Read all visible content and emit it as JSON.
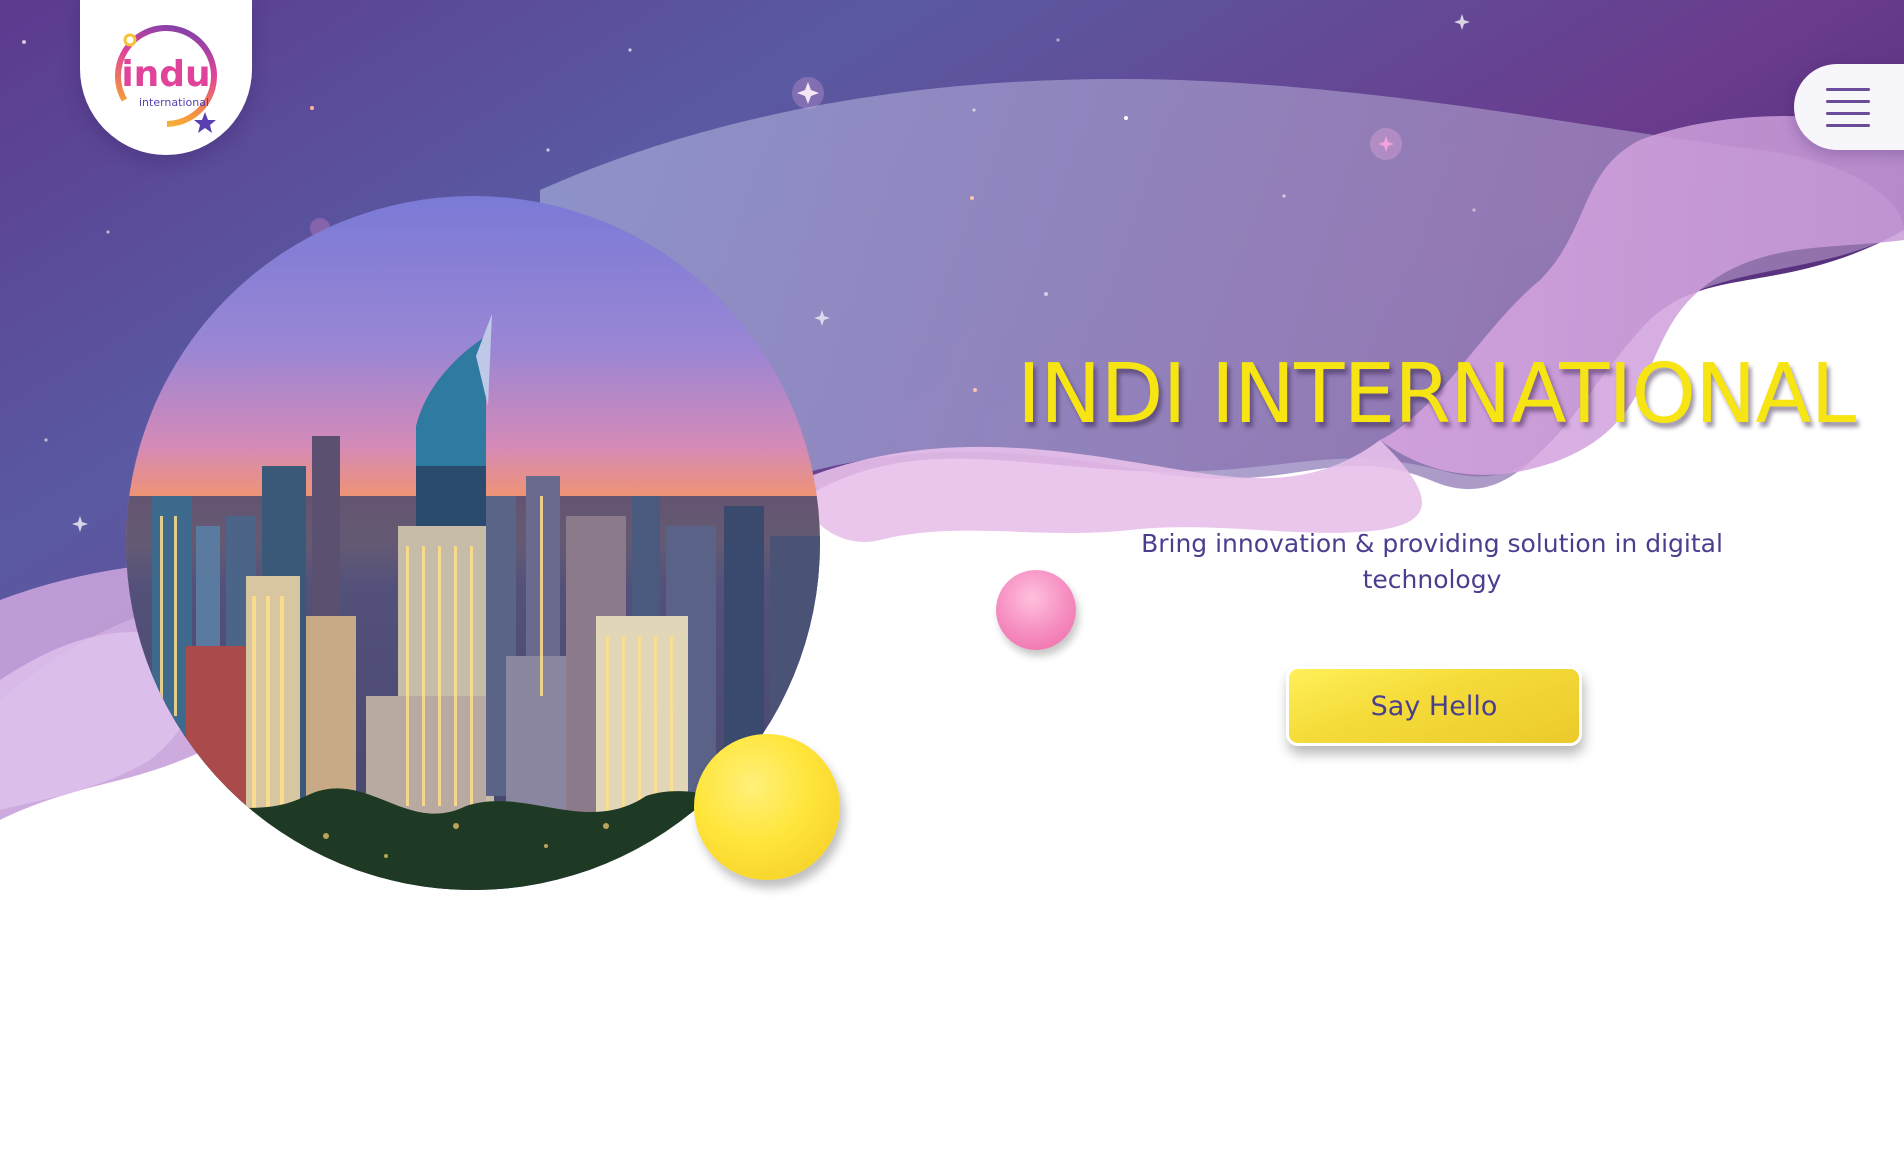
{
  "brand": {
    "logo_word": "indu",
    "logo_subtitle": "international"
  },
  "hero": {
    "title": "INDI INTERNATIONAL",
    "subtitle": "Bring innovation & providing solution in digital technology",
    "cta_label": "Say Hello"
  },
  "theme": {
    "bg_purple_dark": "#5a3588",
    "bg_purple_light": "#8c8ac0",
    "wave_pink": "#e6b8e8",
    "title_yellow": "#f7e413",
    "text_indigo": "#4a3f8e",
    "button_yellow": "#f5dc3a",
    "ball_pink": "#f58bbf"
  },
  "icons": {
    "menu": "hamburger-icon",
    "decor": "sparkle-star-icon"
  }
}
